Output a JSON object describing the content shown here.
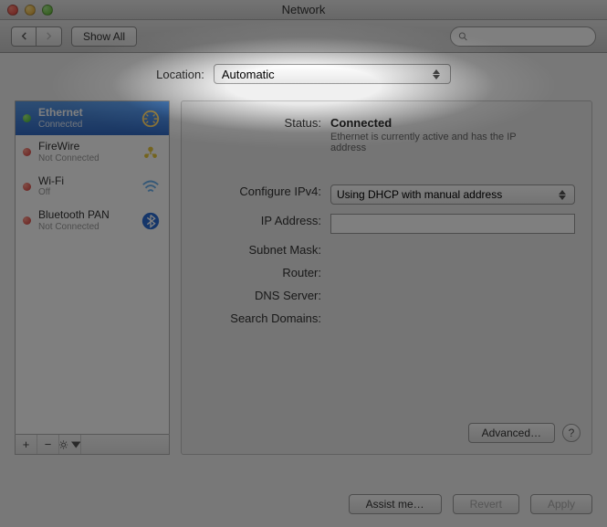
{
  "window": {
    "title": "Network"
  },
  "toolbar": {
    "show_all": "Show All",
    "search_placeholder": ""
  },
  "location": {
    "label": "Location:",
    "value": "Automatic"
  },
  "services": [
    {
      "name": "Ethernet",
      "status": "Connected",
      "dot": "green",
      "icon": "ethernet",
      "selected": true
    },
    {
      "name": "FireWire",
      "status": "Not Connected",
      "dot": "red",
      "icon": "firewire",
      "selected": false
    },
    {
      "name": "Wi-Fi",
      "status": "Off",
      "dot": "red",
      "icon": "wifi",
      "selected": false
    },
    {
      "name": "Bluetooth PAN",
      "status": "Not Connected",
      "dot": "red",
      "icon": "bluetooth",
      "selected": false
    }
  ],
  "detail": {
    "status_label": "Status:",
    "status_value": "Connected",
    "status_desc": "Ethernet is currently active and has the IP address",
    "configure_label": "Configure IPv4:",
    "configure_value": "Using DHCP with manual address",
    "ip_label": "IP Address:",
    "ip_value": "",
    "subnet_label": "Subnet Mask:",
    "router_label": "Router:",
    "dns_label": "DNS Server:",
    "search_label": "Search Domains:",
    "advanced": "Advanced…",
    "help": "?"
  },
  "footer": {
    "assist": "Assist me…",
    "revert": "Revert",
    "apply": "Apply"
  }
}
